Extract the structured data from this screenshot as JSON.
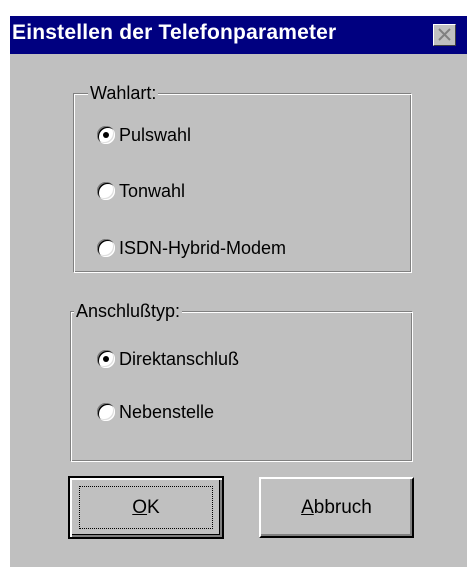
{
  "window": {
    "title": "Einstellen der Telefonparameter",
    "close_icon": "close-icon"
  },
  "dial_type": {
    "legend": "Wahlart:",
    "options": [
      {
        "label": "Pulswahl",
        "selected": true
      },
      {
        "label": "Tonwahl",
        "selected": false
      },
      {
        "label": "ISDN-Hybrid-Modem",
        "selected": false
      }
    ]
  },
  "connection_type": {
    "legend": "Anschlußtyp:",
    "options": [
      {
        "label": "Direktanschluß",
        "selected": true
      },
      {
        "label": "Nebenstelle",
        "selected": false
      }
    ]
  },
  "buttons": {
    "ok": {
      "accel": "O",
      "rest": "K"
    },
    "cancel": {
      "accel": "A",
      "rest": "bbruch"
    }
  }
}
